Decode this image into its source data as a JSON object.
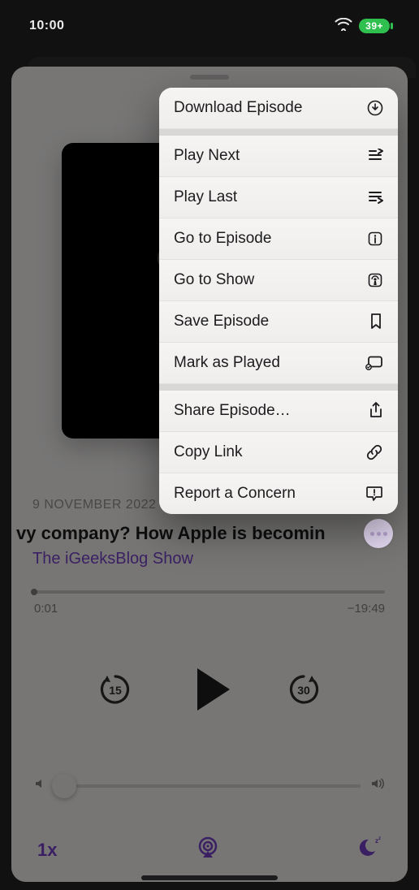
{
  "status": {
    "time": "10:00",
    "battery_text": "39+"
  },
  "episode": {
    "date": "9 NOVEMBER 2022",
    "title": "vy company?    How Apple is becomin",
    "show": "The iGeeksBlog Show"
  },
  "scrubber": {
    "elapsed": "0:01",
    "remaining": "−19:49"
  },
  "playback": {
    "skip_back": "15",
    "skip_forward": "30",
    "speed": "1x"
  },
  "menu": {
    "items": [
      {
        "label": "Download Episode",
        "icon": "download-icon"
      },
      {
        "label": "Play Next",
        "icon": "play-next-icon"
      },
      {
        "label": "Play Last",
        "icon": "play-last-icon"
      },
      {
        "label": "Go to Episode",
        "icon": "info-icon"
      },
      {
        "label": "Go to Show",
        "icon": "podcast-icon"
      },
      {
        "label": "Save Episode",
        "icon": "bookmark-icon"
      },
      {
        "label": "Mark as Played",
        "icon": "played-icon"
      },
      {
        "label": "Share Episode…",
        "icon": "share-icon"
      },
      {
        "label": "Copy Link",
        "icon": "link-icon"
      },
      {
        "label": "Report a Concern",
        "icon": "report-icon"
      }
    ]
  },
  "colors": {
    "accent": "#6f3fbf",
    "battery": "#2fbf4f"
  }
}
